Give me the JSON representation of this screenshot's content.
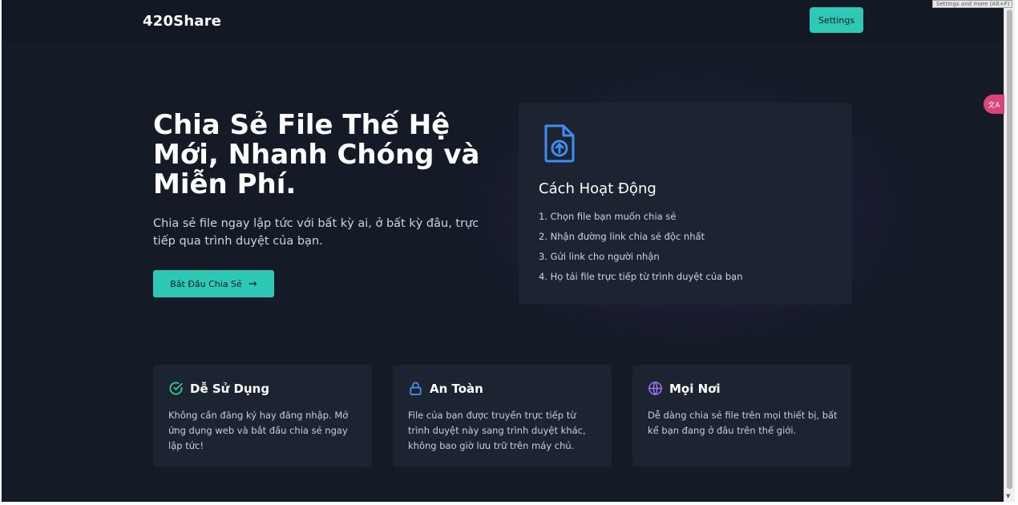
{
  "header": {
    "brand": "420Share",
    "settings_label": "Settings"
  },
  "hero": {
    "title": "Chia Sẻ File Thế Hệ Mới, Nhanh Chóng và Miễn Phí.",
    "subtitle": "Chia sẻ file ngay lập tức với bất kỳ ai, ở bất kỳ đâu, trực tiếp qua trình duyệt của bạn.",
    "cta_label": "Bắt Đầu Chia Sẻ",
    "cta_icon": "arrow-right-icon"
  },
  "how_it_works": {
    "icon": "file-upload-icon",
    "title": "Cách Hoạt Động",
    "steps": [
      "1. Chọn file bạn muốn chia sẻ",
      "2. Nhận đường link chia sẻ độc nhất",
      "3. Gửi link cho người nhận",
      "4. Họ tải file trực tiếp từ trình duyệt của bạn"
    ]
  },
  "features": [
    {
      "icon": "check-circle-icon",
      "title": "Dễ Sử Dụng",
      "text": "Không cần đăng ký hay đăng nhập. Mở ứng dụng web và bắt đầu chia sẻ ngay lập tức!"
    },
    {
      "icon": "lock-icon",
      "title": "An Toàn",
      "text": "File của bạn được truyền trực tiếp từ trình duyệt này sang trình duyệt khác, không bao giờ lưu trữ trên máy chủ."
    },
    {
      "icon": "globe-icon",
      "title": "Mọi Nơi",
      "text": "Dễ dàng chia sẻ file trên mọi thiết bị, bất kể bạn đang ở đâu trên thế giới."
    }
  ],
  "browser": {
    "tooltip": "Settings and more (Alt+F)"
  },
  "colors": {
    "background": "#141a26",
    "card": "#1d2431",
    "accent": "#2dc9b4",
    "check_icon": "#3ecf8e",
    "lock_icon": "#4f8ff7",
    "globe_icon": "#a374f2",
    "file_icon": "#3f8df5"
  }
}
